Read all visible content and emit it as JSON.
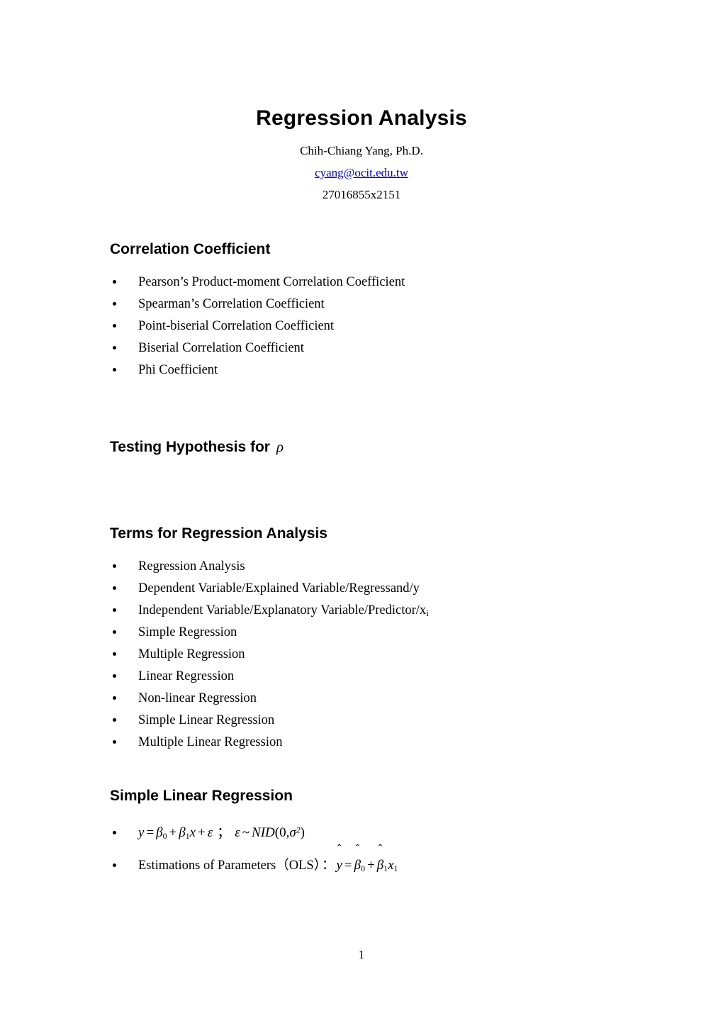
{
  "document": {
    "title": "Regression Analysis",
    "author": "Chih-Chiang Yang, Ph.D.",
    "email": "cyang@ocit.edu.tw",
    "phone": "27016855x2151",
    "page_number": "1",
    "link_color": "#0000CC",
    "text_color": "#000000",
    "background_color": "#FFFFFF"
  },
  "sections": [
    {
      "heading": "Correlation Coefficient",
      "items": [
        "Pearson’s Product-moment Correlation Coefficient",
        "Spearman’s Correlation Coefficient",
        "Point-biserial Correlation Coefficient",
        "Biserial Correlation Coefficient",
        "Phi Coefficient"
      ]
    },
    {
      "heading": "Testing Hypothesis for",
      "heading_symbol": "ρ",
      "items": []
    },
    {
      "heading": "Terms for Regression Analysis",
      "items": [
        "Regression Analysis",
        "Dependent Variable/Explained Variable/Regressand/y",
        "Independent Variable/Explanatory Variable/Predictor/x",
        "Simple Regression",
        "Multiple Regression",
        "Linear Regression",
        "Non-linear Regression",
        "Simple Linear Regression",
        "Multiple Linear Regression"
      ],
      "item_3_subscript": "i"
    },
    {
      "heading": "Simple Linear Regression",
      "equations": [
        {
          "plain": "y = β₀ + β₁x + ε ; ε ~ NID(0,σ²)",
          "parts": {
            "y": "y",
            "eq": "=",
            "beta": "β",
            "sub0": "0",
            "plus": "+",
            "sub1": "1",
            "x": "x",
            "epsilon": "ε",
            "semicolon": "；",
            "tilde": "~",
            "nid": "NID",
            "open": "(",
            "zero": "0",
            "comma": ",",
            "sigma": "σ",
            "sup2": "2",
            "close": ")"
          }
        },
        {
          "label": "Estimations of Parameters",
          "paren_open": "（",
          "method": "OLS",
          "paren_close": "）",
          "colon": "：",
          "plain": "ŷ = β̂₀ + β̂₁x₁",
          "parts": {
            "yhat": "y",
            "hat": "ˆ",
            "eq": "=",
            "beta": "β",
            "sub0": "0",
            "plus": "+",
            "sub1": "1",
            "x": "x",
            "xsub1": "1"
          }
        }
      ]
    }
  ]
}
